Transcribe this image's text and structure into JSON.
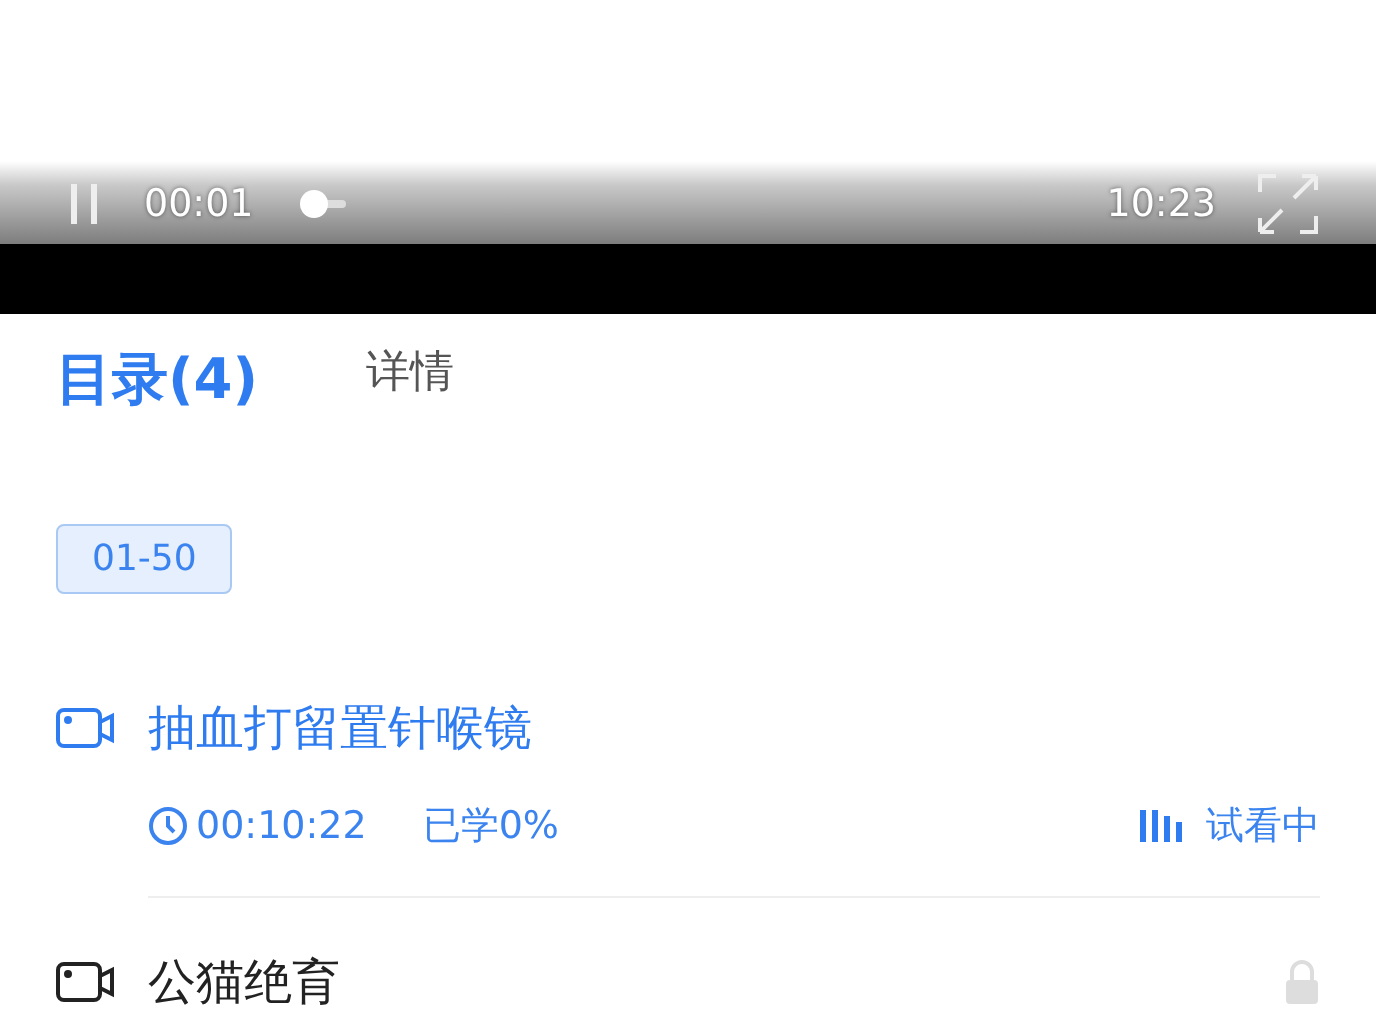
{
  "player": {
    "playing": true,
    "current_time": "00:01",
    "duration": "10:23",
    "level": 0.01
  },
  "tabs": [
    {
      "label": "目录(4)",
      "selected": true
    },
    {
      "label": "详情",
      "selected": false
    }
  ],
  "range_chip": {
    "label": "01-50",
    "selected": true
  },
  "lessons": [
    {
      "title": "抽血打留置针喉镜",
      "playing": true,
      "locked": false,
      "duration": "00:10:22",
      "progress": "已学0%",
      "status": "试看中"
    },
    {
      "title": "公猫绝育",
      "playing": false,
      "locked": true
    }
  ]
}
